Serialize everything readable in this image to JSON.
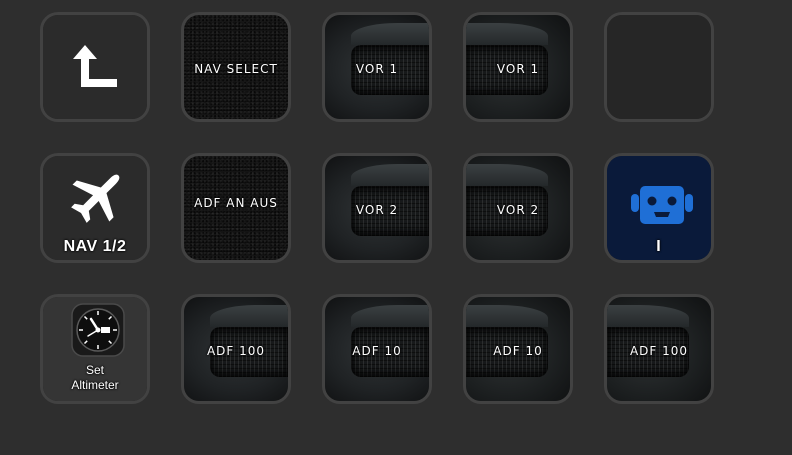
{
  "keys": {
    "back": {
      "icon": "back-arrow-icon"
    },
    "nav_select": {
      "label": "NAV SELECT"
    },
    "vor1_left": {
      "label": "VOR 1"
    },
    "vor1_right": {
      "label": "VOR 1"
    },
    "empty": {
      "label": ""
    },
    "nav": {
      "icon": "airplane-icon",
      "label": "NAV 1/2"
    },
    "adf_on_off": {
      "label": "ADF AN AUS"
    },
    "vor2_left": {
      "label": "VOR 2"
    },
    "vor2_right": {
      "label": "VOR 2"
    },
    "bot": {
      "icon": "robot-icon",
      "label": "I",
      "color": "#1f6fd6"
    },
    "set_altimeter": {
      "icon": "altimeter-icon",
      "line1": "Set",
      "line2": "Altimeter"
    },
    "adf100_left": {
      "label": "ADF 100"
    },
    "adf10_left": {
      "label": "ADF 10"
    },
    "adf10_right": {
      "label": "ADF 10"
    },
    "adf100_right": {
      "label": "ADF 100"
    }
  }
}
